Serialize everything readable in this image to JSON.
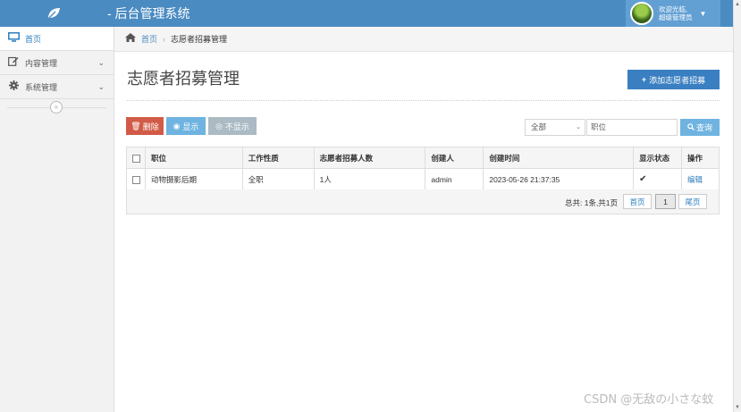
{
  "header": {
    "app_title": "- 后台管理系统",
    "user_line1": "欢迎光临,",
    "user_line2": "超级管理员",
    "logo_icon": "leaf-icon",
    "caret_icon": "caret-down-icon"
  },
  "sidebar": {
    "items": [
      {
        "label": "首页",
        "icon": "desktop-icon"
      },
      {
        "label": "内容管理",
        "icon": "edit-icon"
      },
      {
        "label": "系统管理",
        "icon": "gear-icon"
      }
    ],
    "collapse_icon": "double-chevron-left-icon"
  },
  "breadcrumb": {
    "home": "首页",
    "current": "志愿者招募管理"
  },
  "page": {
    "title": "志愿者招募管理",
    "add_button": "添加志愿者招募"
  },
  "toolbar": {
    "delete": "删除",
    "show": "显示",
    "hide": "不显示",
    "filter_selected": "全部",
    "search_placeholder": "职位",
    "search_button": "查询"
  },
  "table": {
    "headers": [
      "职位",
      "工作性质",
      "志愿者招募人数",
      "创建人",
      "创建时间",
      "显示状态",
      "操作"
    ],
    "rows": [
      {
        "position": "动物摄影后期",
        "nature": "全职",
        "count": "1人",
        "creator": "admin",
        "created": "2023-05-26 21:37:35",
        "status_icon": "check-icon",
        "action": "编辑"
      }
    ]
  },
  "pager": {
    "total": "总共: 1条,共1页",
    "first": "首页",
    "current": "1",
    "last": "尾页"
  },
  "watermark": "CSDN @无敌の小さな蚊",
  "colors": {
    "navbar": "#4a8bc2",
    "primary": "#3a7fc1",
    "danger": "#d15b47",
    "info": "#6fb3e0",
    "muted": "#abbac3"
  }
}
